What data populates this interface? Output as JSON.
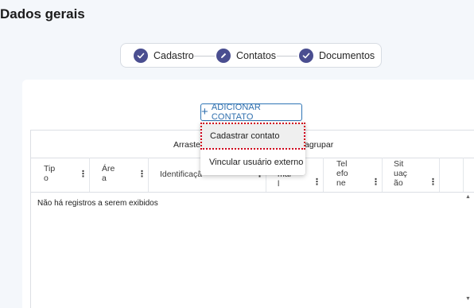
{
  "page": {
    "title": "Dados gerais"
  },
  "stepper": {
    "steps": [
      {
        "label": "Cadastro",
        "icon": "check-icon"
      },
      {
        "label": "Contatos",
        "icon": "pencil-icon"
      },
      {
        "label": "Documentos",
        "icon": "check-icon"
      }
    ],
    "color": "#4a4e90"
  },
  "toolbar": {
    "add_button_label": "ADICIONAR CONTATO",
    "add_icon": "plus-icon"
  },
  "dropdown": {
    "items": [
      {
        "label": "Cadastrar contato"
      },
      {
        "label": "Vincular usuário externo"
      }
    ]
  },
  "grid": {
    "group_panel_left": "Arraste",
    "group_panel_right": "agrupar",
    "columns": [
      {
        "label": "Tip\no"
      },
      {
        "label": "Áre\na"
      },
      {
        "label": "Identificaçã"
      },
      {
        "label": "mai\nl"
      },
      {
        "label": "Tel\nefo\nne"
      },
      {
        "label": "Sit\nuaç\não"
      }
    ],
    "empty_message": "Não há registros a serem exibidos"
  },
  "colors": {
    "accent": "#2f75b5",
    "highlight_outline": "#d0021b"
  }
}
